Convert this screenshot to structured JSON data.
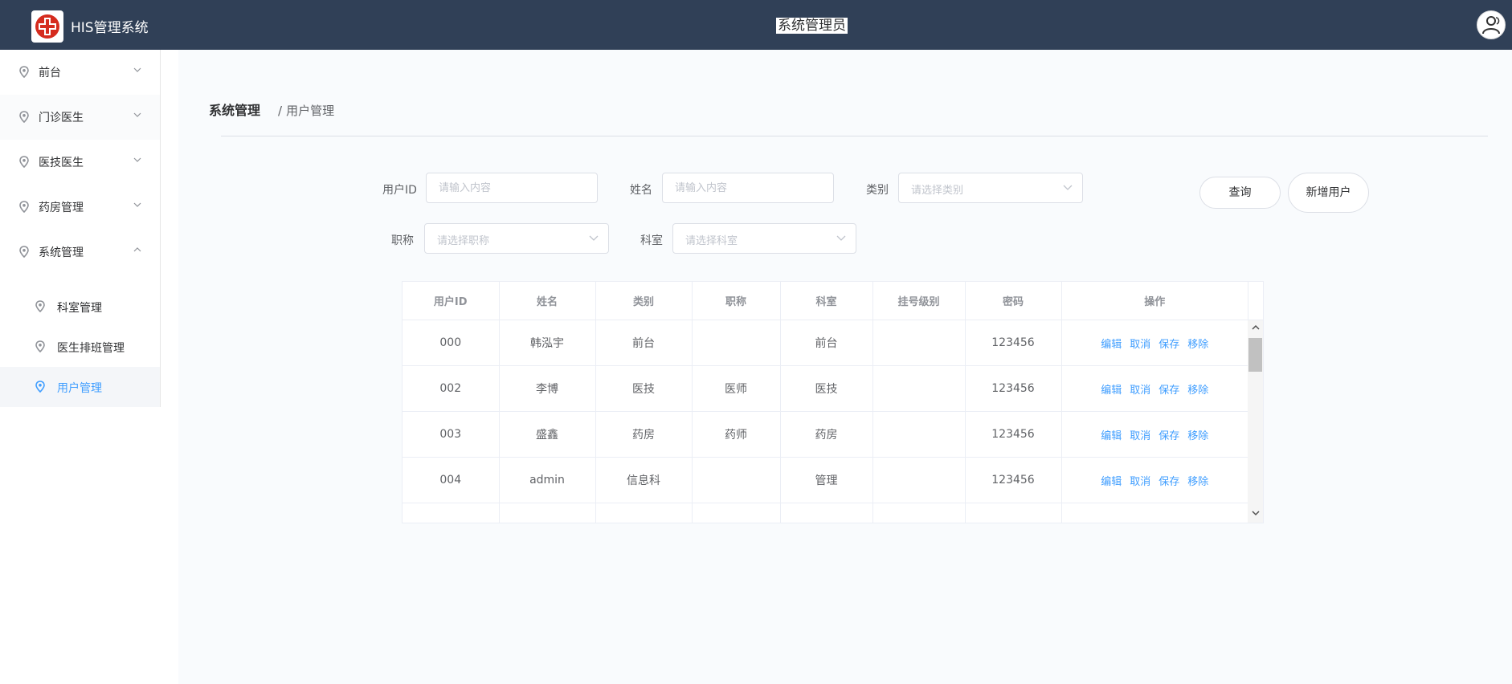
{
  "header": {
    "app_title": "HIS管理系统",
    "role_title": "系统管理员",
    "bg_color": "#304057"
  },
  "sidebar": {
    "items": [
      {
        "label": "前台",
        "icon": "location-pin-icon",
        "expanded": false
      },
      {
        "label": "门诊医生",
        "icon": "location-pin-icon",
        "expanded": false
      },
      {
        "label": "医技医生",
        "icon": "location-pin-icon",
        "expanded": false
      },
      {
        "label": "药房管理",
        "icon": "location-pin-icon",
        "expanded": false
      },
      {
        "label": "系统管理",
        "icon": "location-pin-icon",
        "expanded": true
      }
    ],
    "sub_items": [
      {
        "label": "科室管理",
        "active": false
      },
      {
        "label": "医生排班管理",
        "active": false
      },
      {
        "label": "用户管理",
        "active": true
      }
    ],
    "active_color": "#409eff"
  },
  "breadcrumb": {
    "root": "系统管理",
    "separator": "/",
    "current": "用户管理"
  },
  "filters": {
    "user_id": {
      "label": "用户ID",
      "placeholder": "请输入内容",
      "value": ""
    },
    "name": {
      "label": "姓名",
      "placeholder": "请输入内容",
      "value": ""
    },
    "category": {
      "label": "类别",
      "placeholder": "请选择类别"
    },
    "title": {
      "label": "职称",
      "placeholder": "请选择职称"
    },
    "department": {
      "label": "科室",
      "placeholder": "请选择科室"
    }
  },
  "buttons": {
    "search": "查询",
    "add_user": "新增用户"
  },
  "table": {
    "columns": [
      "用户ID",
      "姓名",
      "类别",
      "职称",
      "科室",
      "挂号级别",
      "密码",
      "操作"
    ],
    "rows": [
      {
        "id": "000",
        "name": "韩泓宇",
        "category": "前台",
        "title": "",
        "department": "前台",
        "level": "",
        "password": "123456"
      },
      {
        "id": "002",
        "name": "李博",
        "category": "医技",
        "title": "医师",
        "department": "医技",
        "level": "",
        "password": "123456"
      },
      {
        "id": "003",
        "name": "盛鑫",
        "category": "药房",
        "title": "药师",
        "department": "药房",
        "level": "",
        "password": "123456"
      },
      {
        "id": "004",
        "name": "admin",
        "category": "信息科",
        "title": "",
        "department": "管理",
        "level": "",
        "password": "123456"
      },
      {
        "id": "",
        "name": "",
        "category": "",
        "title": "",
        "department": "",
        "level": "",
        "password": ""
      }
    ],
    "actions": [
      "编辑",
      "取消",
      "保存",
      "移除"
    ]
  }
}
